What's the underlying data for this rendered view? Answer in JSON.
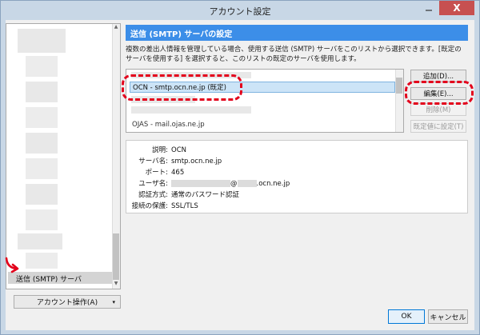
{
  "window": {
    "title": "アカウント設定",
    "controls": {
      "minimize_icon": "minimize-icon",
      "close_icon": "close-icon",
      "close_glyph": "X"
    }
  },
  "sidebar": {
    "selected_item": "送信 (SMTP) サーバ",
    "account_actions_button": "アカウント操作(A)",
    "account_actions_arrow": "▾"
  },
  "panel": {
    "header": "送信 (SMTP) サーバの設定",
    "description": "複数の差出人情報を管理している場合、使用する送信 (SMTP) サーバをこのリストから選択できます。[既定のサーバを使用する] を選択すると、このリストの既定のサーバを使用します。",
    "server_list": {
      "selected": "OCN - smtp.ocn.ne.jp (既定)",
      "partial_row": "OJAS - mail.ojas.ne.jp"
    },
    "buttons": {
      "add": "追加(D)...",
      "edit": "編集(E)...",
      "delete": "削除(M)",
      "set_default": "既定値に設定(T)"
    },
    "details": [
      {
        "label": "説明:",
        "value": "OCN"
      },
      {
        "label": "サーバ名:",
        "value": "smtp.ocn.ne.jp"
      },
      {
        "label": "ポート:",
        "value": "465"
      },
      {
        "label": "ユーザ名:",
        "value_at": "@",
        "value_domain": ".ocn.ne.jp"
      },
      {
        "label": "認証方式:",
        "value": "通常のパスワード認証"
      },
      {
        "label": "接続の保護:",
        "value": "SSL/TLS"
      }
    ]
  },
  "footer": {
    "ok": "OK",
    "cancel": "キャンセル"
  },
  "colors": {
    "header_blue": "#3c8ee8",
    "annotation_red": "#e3001b",
    "close_red": "#c75050"
  }
}
